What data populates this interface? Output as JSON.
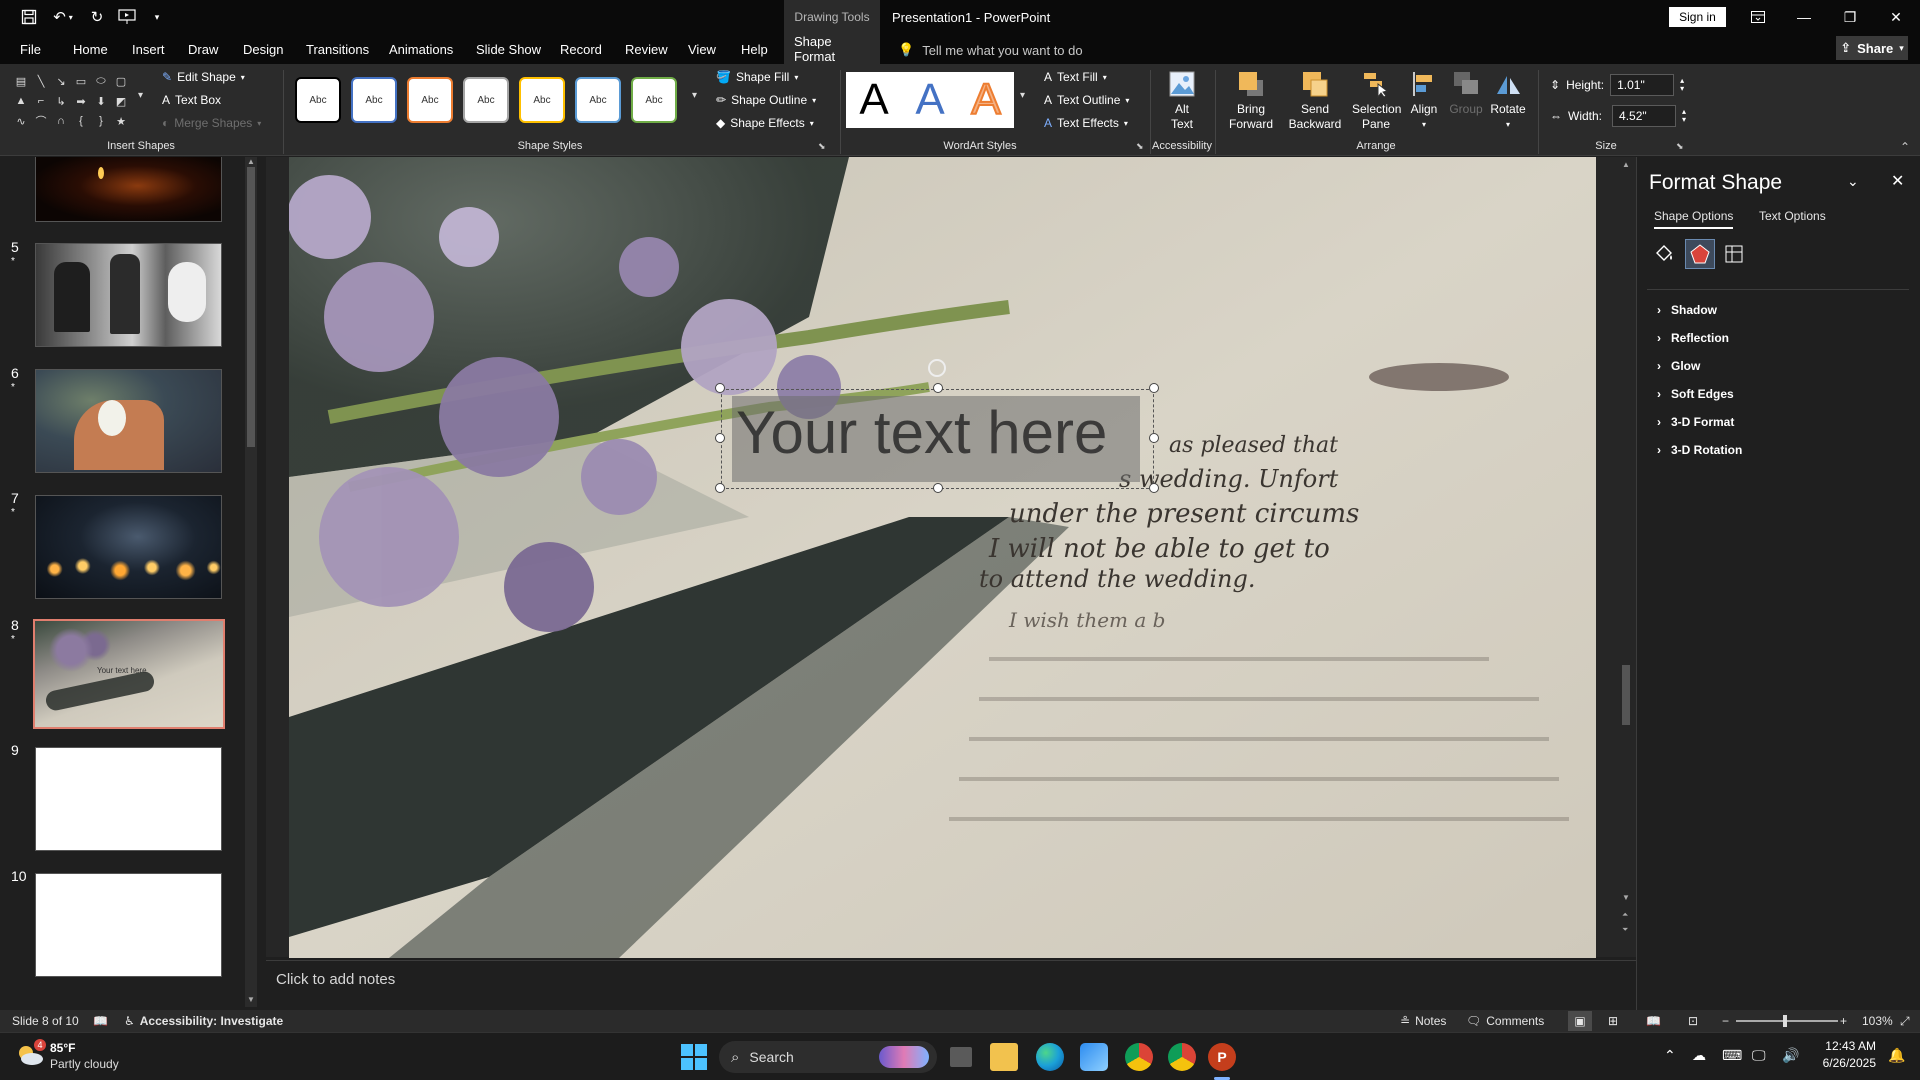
{
  "app": {
    "title": "Presentation1  -  PowerPoint",
    "contextual_tab": "Drawing Tools",
    "sign_in": "Sign in",
    "share": "Share"
  },
  "tabs": [
    "File",
    "Home",
    "Insert",
    "Draw",
    "Design",
    "Transitions",
    "Animations",
    "Slide Show",
    "Record",
    "Review",
    "View",
    "Help",
    "Shape Format"
  ],
  "tell_me": "Tell me what you want to do",
  "ribbon": {
    "insert_shapes": {
      "label": "Insert Shapes",
      "edit_shape": "Edit Shape",
      "text_box": "Text Box",
      "merge_shapes": "Merge Shapes"
    },
    "shape_styles": {
      "label": "Shape Styles",
      "style_text": "Abc",
      "shape_fill": "Shape Fill",
      "shape_outline": "Shape Outline",
      "shape_effects": "Shape Effects",
      "style_colors": [
        "#000000",
        "#4472c4",
        "#ed7d31",
        "#a5a5a5",
        "#ffc000",
        "#5b9bd5",
        "#70ad47"
      ]
    },
    "wordart_styles": {
      "label": "WordArt Styles",
      "letter": "A",
      "text_fill": "Text Fill",
      "text_outline": "Text Outline",
      "text_effects": "Text Effects"
    },
    "accessibility": {
      "label": "Accessibility",
      "alt_text": "Alt Text"
    },
    "arrange": {
      "label": "Arrange",
      "bring_forward": "Bring Forward",
      "send_backward": "Send Backward",
      "selection_pane": "Selection Pane",
      "align": "Align",
      "group": "Group",
      "rotate": "Rotate"
    },
    "size": {
      "label": "Size",
      "height_label": "Height:",
      "height_value": "1.01\"",
      "width_label": "Width:",
      "width_value": "4.52\""
    }
  },
  "slides": [
    {
      "number": "5",
      "star": "*"
    },
    {
      "number": "6",
      "star": "*"
    },
    {
      "number": "7",
      "star": "*"
    },
    {
      "number": "8",
      "star": "*",
      "caption": "Your text here"
    },
    {
      "number": "9"
    },
    {
      "number": "10"
    }
  ],
  "canvas": {
    "textbox": "Your text here",
    "handwriting": [
      "under the present circums",
      "I will not be able to get to",
      "to attend the wedding.",
      "s wedding. Unfort",
      "as pleased that",
      "I wish them a b"
    ]
  },
  "notes_placeholder": "Click to add notes",
  "format_pane": {
    "title": "Format Shape",
    "tabs": [
      "Shape Options",
      "Text Options"
    ],
    "sections": [
      "Shadow",
      "Reflection",
      "Glow",
      "Soft Edges",
      "3-D Format",
      "3-D Rotation"
    ]
  },
  "status": {
    "slide_info": "Slide 8 of 10",
    "accessibility": "Accessibility: Investigate",
    "notes": "Notes",
    "comments": "Comments",
    "zoom": "103%"
  },
  "taskbar": {
    "weather_temp": "85°F",
    "weather_desc": "Partly cloudy",
    "weather_badge": "4",
    "search": "Search",
    "time": "12:43 AM",
    "date": "6/26/2025"
  }
}
